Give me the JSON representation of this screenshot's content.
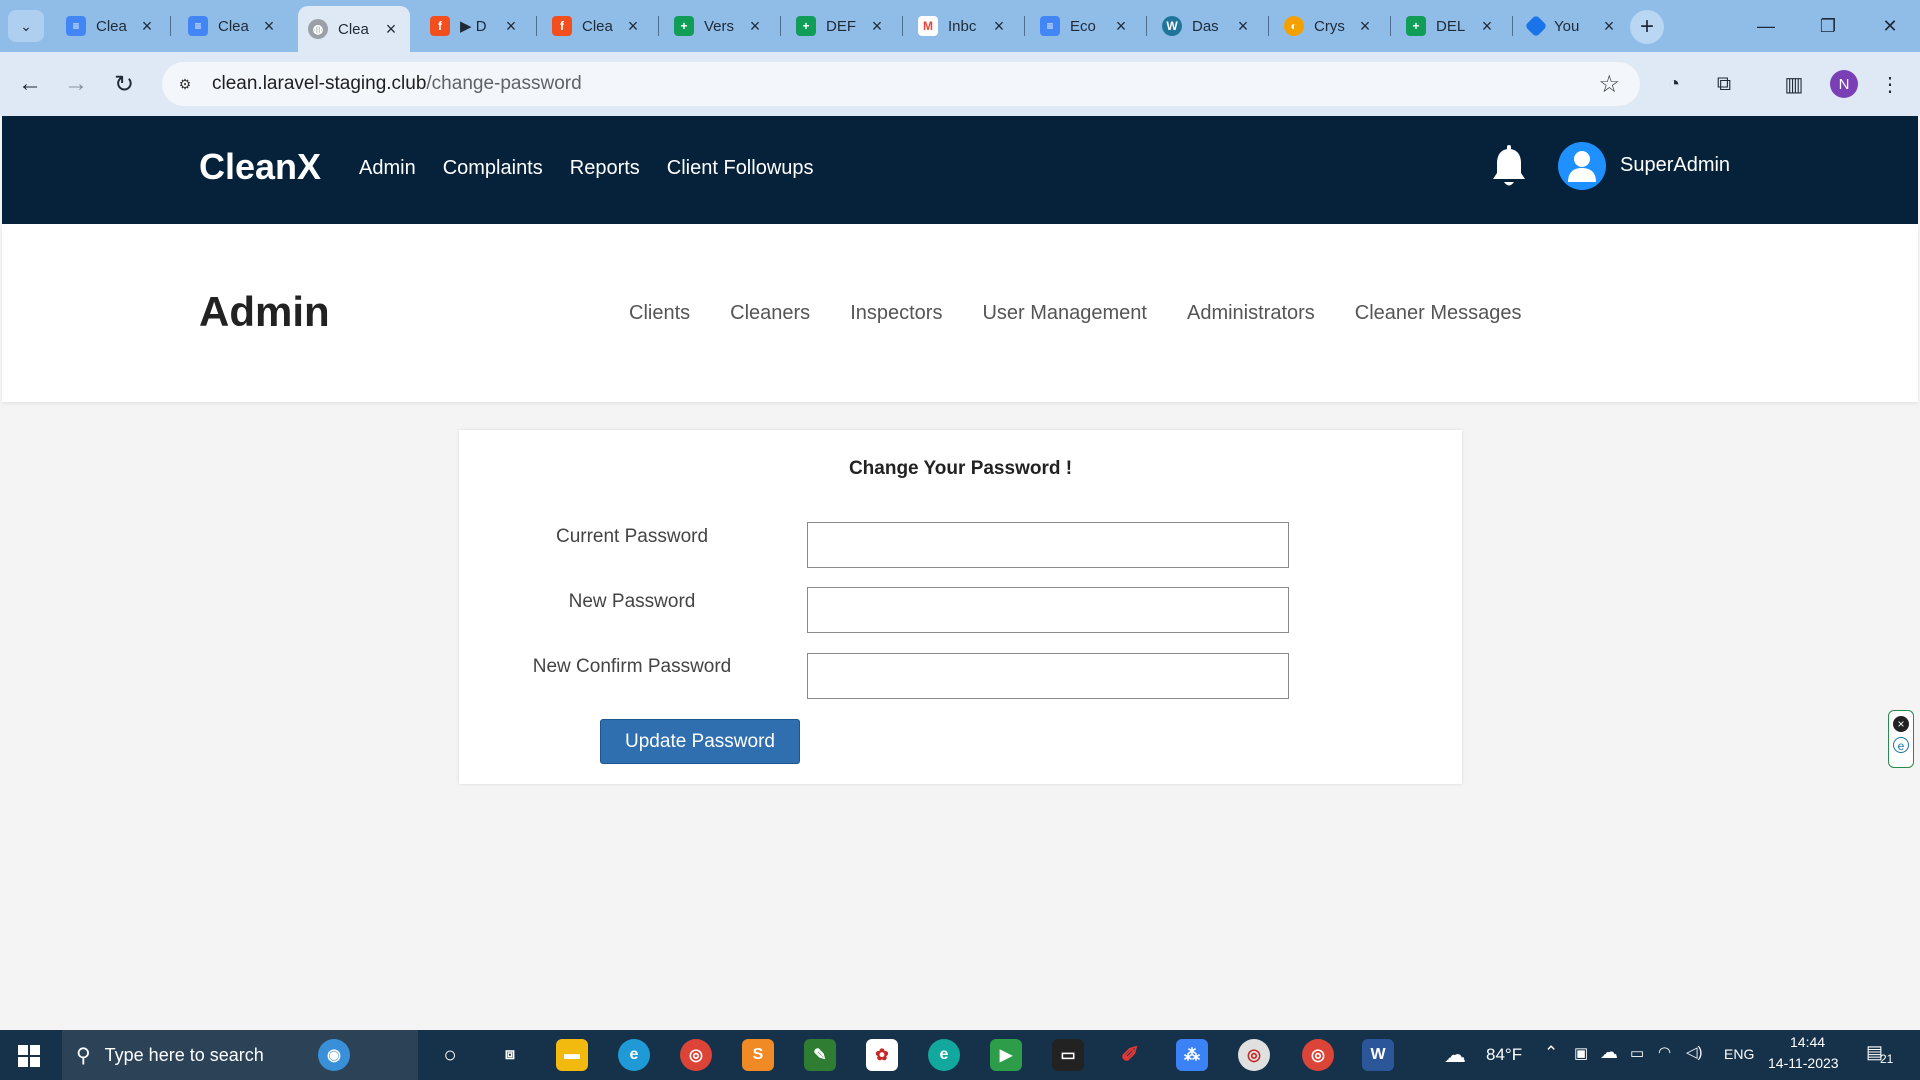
{
  "browser": {
    "tabs": [
      {
        "title": "Clea",
        "icon": "docs-icon",
        "color": "#4285f4"
      },
      {
        "title": "Clea",
        "icon": "docs-icon",
        "color": "#4285f4"
      },
      {
        "title": "Clea",
        "icon": "globe-icon",
        "color": "#9aa0a6"
      },
      {
        "title": "▶ D",
        "icon": "figma-icon",
        "color": "#f24e1e"
      },
      {
        "title": "Clea",
        "icon": "figma-icon",
        "color": "#f24e1e"
      },
      {
        "title": "Vers",
        "icon": "sheets-icon",
        "color": "#0f9d58"
      },
      {
        "title": "DEF",
        "icon": "sheets-icon",
        "color": "#0f9d58"
      },
      {
        "title": "Inbc",
        "icon": "gmail-icon",
        "color": "#ea4335"
      },
      {
        "title": "Eco",
        "icon": "docs-icon",
        "color": "#4285f4"
      },
      {
        "title": "Das",
        "icon": "wordpress-icon",
        "color": "#21759b"
      },
      {
        "title": "Crys",
        "icon": "crystal-icon",
        "color": "#f4a100"
      },
      {
        "title": "DEL",
        "icon": "sheets-icon",
        "color": "#0f9d58"
      },
      {
        "title": "You",
        "icon": "diamond-icon",
        "color": "#1a73e8"
      }
    ],
    "url_host": "clean.laravel-staging.club",
    "url_path": "/change-password",
    "profile_initial": "N"
  },
  "site": {
    "brand": "CleanX",
    "menu": [
      "Admin",
      "Complaints",
      "Reports",
      "Client Followups"
    ],
    "username": "SuperAdmin",
    "page_title": "Admin",
    "submenu": [
      "Clients",
      "Cleaners",
      "Inspectors",
      "User Management",
      "Administrators",
      "Cleaner Messages"
    ]
  },
  "form": {
    "title": "Change Your Password !",
    "current_label": "Current Password",
    "current_value": "",
    "new_label": "New Password",
    "new_value": "",
    "confirm_label": "New Confirm Password",
    "confirm_value": "",
    "submit_label": "Update Password"
  },
  "taskbar": {
    "search_placeholder": "Type here to search",
    "weather": "84°F",
    "language": "ENG",
    "time": "14:44",
    "date": "14-11-2023",
    "notifications": "21"
  }
}
